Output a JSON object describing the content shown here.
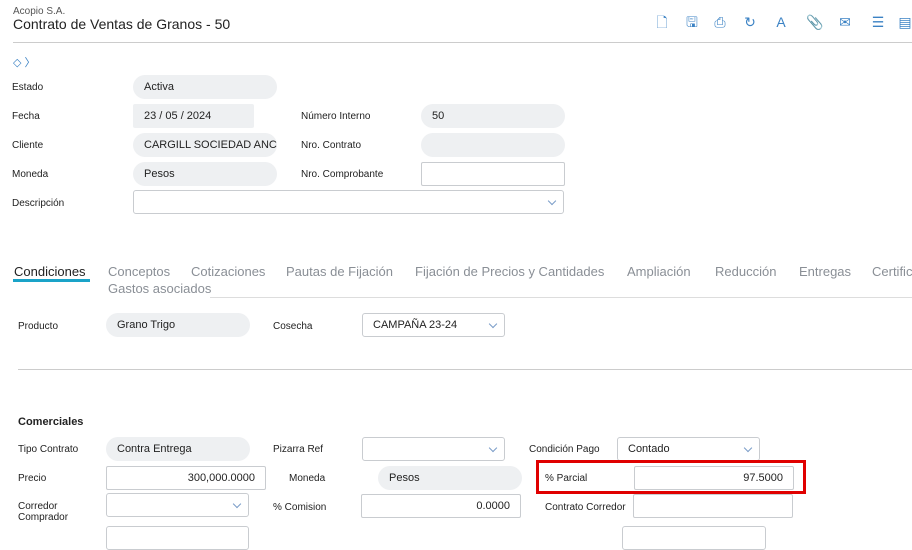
{
  "header": {
    "company": "Acopio S.A.",
    "title": "Contrato de Ventas de Granos - 50"
  },
  "toolbar": [
    {
      "icon": "new-document-icon",
      "glyph": "🗋"
    },
    {
      "icon": "save-icon",
      "glyph": "🖫"
    },
    {
      "icon": "print-icon",
      "glyph": "⎙"
    },
    {
      "icon": "refresh-icon",
      "glyph": "↻"
    },
    {
      "icon": "text-document-icon",
      "glyph": "A"
    },
    {
      "icon": "attach-icon",
      "glyph": "📎"
    },
    {
      "icon": "mail-icon",
      "glyph": "✉"
    },
    {
      "icon": "checklist-icon",
      "glyph": "☰"
    },
    {
      "icon": "list-icon",
      "glyph": "▤"
    }
  ],
  "form": {
    "estado_label": "Estado",
    "estado": "Activa",
    "fecha_label": "Fecha",
    "fecha": "23 / 05 / 2024",
    "numero_interno_label": "Número Interno",
    "numero_interno": "50",
    "cliente_label": "Cliente",
    "cliente": "CARGILL SOCIEDAD ANC",
    "nro_contrato_label": "Nro. Contrato",
    "nro_contrato": "",
    "moneda_label": "Moneda",
    "moneda": "Pesos",
    "nro_comprobante_label": "Nro. Comprobante",
    "nro_comprobante": "",
    "descripcion_label": "Descripción",
    "descripcion": ""
  },
  "tabs": [
    "Condiciones",
    "Conceptos",
    "Cotizaciones",
    "Pautas de Fijación",
    "Fijación de Precios y Cantidades",
    "Ampliación",
    "Reducción",
    "Entregas",
    "Certific",
    "Gastos asociados"
  ],
  "condiciones": {
    "producto_label": "Producto",
    "producto": "Grano Trigo",
    "cosecha_label": "Cosecha",
    "cosecha": "CAMPAÑA 23-24"
  },
  "comerciales": {
    "title": "Comerciales",
    "tipo_contrato_label": "Tipo Contrato",
    "tipo_contrato": "Contra Entrega",
    "pizarra_label": "Pizarra Ref",
    "pizarra": "",
    "condicion_pago_label": "Condición Pago",
    "condicion_pago": "Contado",
    "precio_label": "Precio",
    "precio": "300,000.0000",
    "moneda_label": "Moneda",
    "moneda": "Pesos",
    "parcial_label": "% Parcial",
    "parcial": "97.5000",
    "corredor_label": "Corredor Comprador",
    "corredor": "",
    "comision_label": "% Comision",
    "comision": "0.0000",
    "contrato_corredor_label": "Contrato Corredor",
    "contrato_corredor": ""
  },
  "colors": {
    "accent": "#1aa3c8",
    "highlight": "#e00000"
  }
}
